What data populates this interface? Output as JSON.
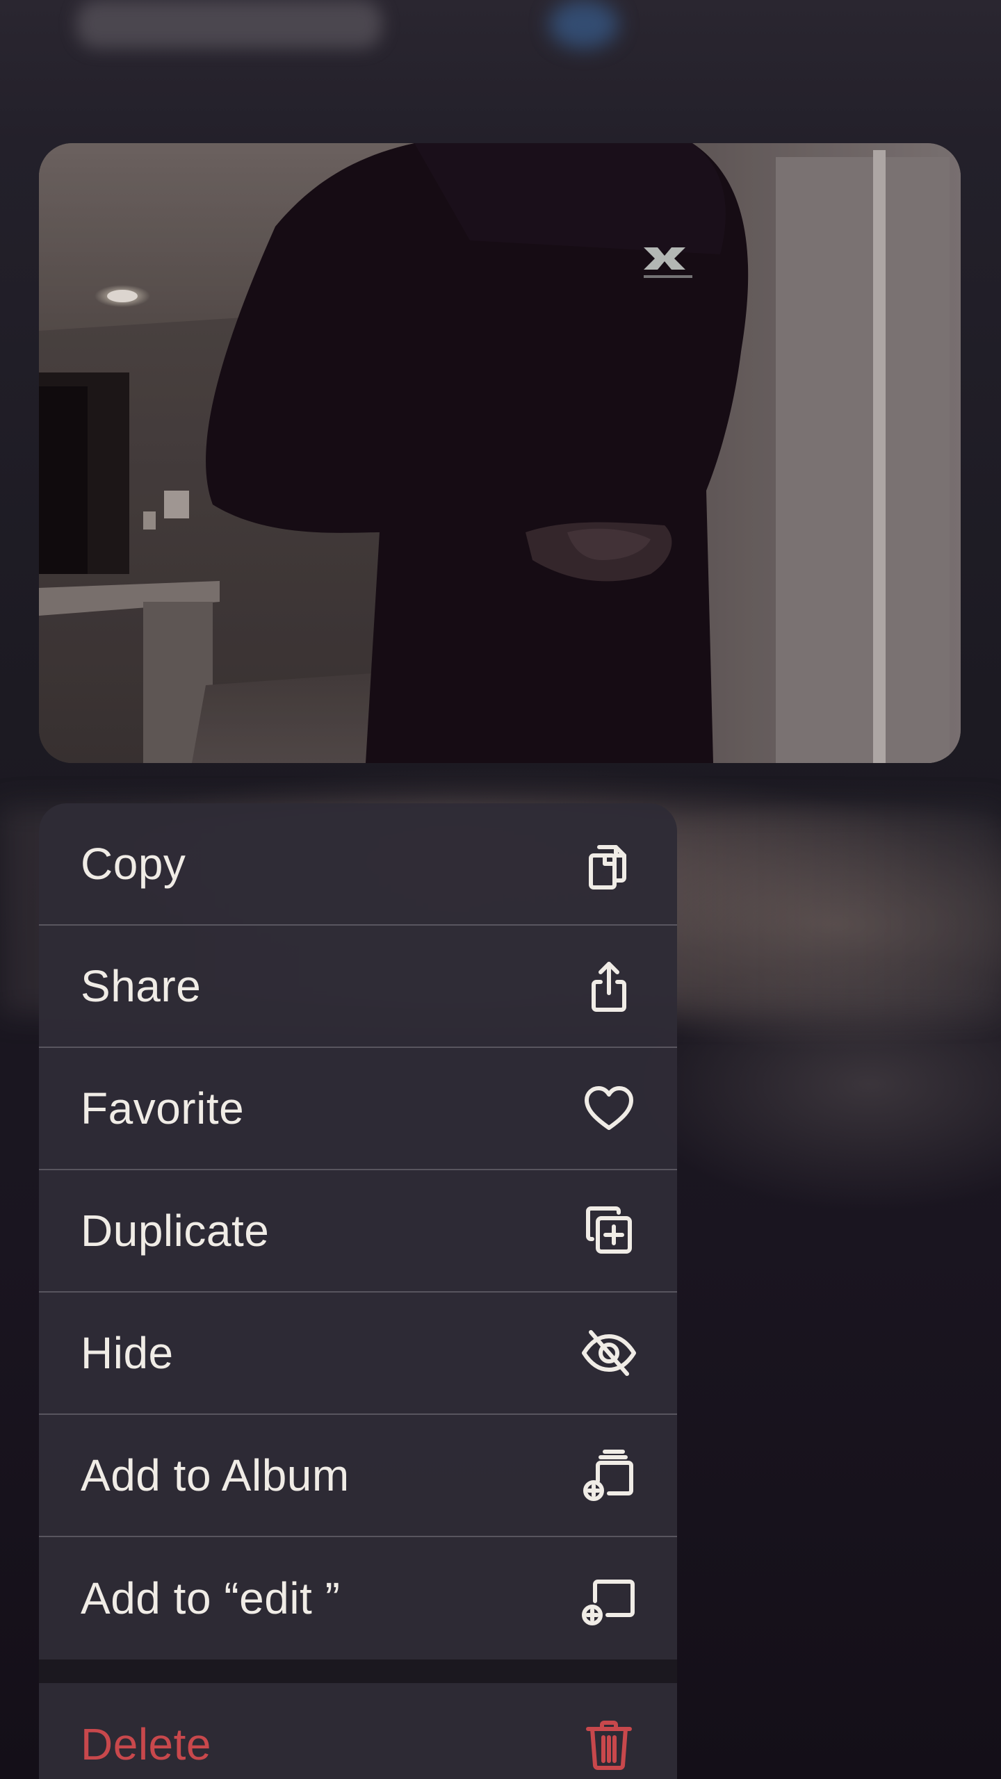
{
  "preview": {
    "description_icon": "photo-preview"
  },
  "menu": {
    "items": [
      {
        "label": "Copy",
        "icon": "copy-icon"
      },
      {
        "label": "Share",
        "icon": "share-icon"
      },
      {
        "label": "Favorite",
        "icon": "heart-icon"
      },
      {
        "label": "Duplicate",
        "icon": "duplicate-icon"
      },
      {
        "label": "Hide",
        "icon": "eye-slash-icon"
      },
      {
        "label": "Add to Album",
        "icon": "add-to-album-icon"
      },
      {
        "label": "Add to “edit ”",
        "icon": "add-to-album-single-icon"
      }
    ],
    "destructive": {
      "label": "Delete",
      "icon": "trash-icon",
      "color": "#c8484c"
    }
  },
  "colors": {
    "menu_bg": "#2e2b36",
    "menu_text": "#f0ece6",
    "destructive": "#c8484c"
  }
}
